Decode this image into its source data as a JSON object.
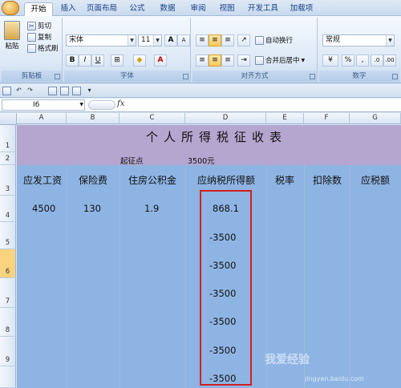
{
  "ribbon": {
    "tabs": [
      "开始",
      "插入",
      "页面布局",
      "公式",
      "数据",
      "审阅",
      "视图",
      "开发工具",
      "加载项"
    ],
    "clipboard": {
      "paste": "粘贴",
      "cut": "剪切",
      "copy": "复制",
      "format_painter": "格式刷",
      "label": "剪贴板"
    },
    "font": {
      "name": "宋体",
      "size": "11",
      "grow": "A",
      "shrink": "A",
      "bold": "B",
      "italic": "I",
      "underline": "U",
      "label": "字体"
    },
    "alignment": {
      "wrap_text": "自动换行",
      "merge_center": "合并后居中",
      "label": "对齐方式"
    },
    "number": {
      "format": "常规",
      "percent": "%",
      "comma": ",",
      "label": "数字"
    }
  },
  "formula_bar": {
    "name_box": "I6",
    "fx": "fx"
  },
  "columns": [
    "A",
    "B",
    "C",
    "D",
    "E",
    "F",
    "G"
  ],
  "rows": [
    "1",
    "2",
    "3",
    "4",
    "5",
    "6",
    "7",
    "8",
    "9"
  ],
  "sheet": {
    "title": "个人所得税征收表",
    "threshold_label": "起征点",
    "threshold_value": "3500元",
    "headers": [
      "应发工资",
      "保险费",
      "住房公积金",
      "应纳税所得额",
      "税率",
      "扣除数",
      "应税额"
    ],
    "row4": {
      "salary": "4500",
      "insurance": "130",
      "housing_fund": "1.9",
      "taxable": "868.1"
    },
    "taxable_values": [
      "-3500",
      "-3500",
      "-3500",
      "-3500",
      "-3500",
      "-3500"
    ]
  },
  "watermark": {
    "text": "我爱经验",
    "url": "jingyan.baidu.com"
  },
  "colors": {
    "title_band": "#b5a6cf",
    "sheet_fill": "#8eb4e3",
    "highlight_box": "#d11f1f"
  }
}
